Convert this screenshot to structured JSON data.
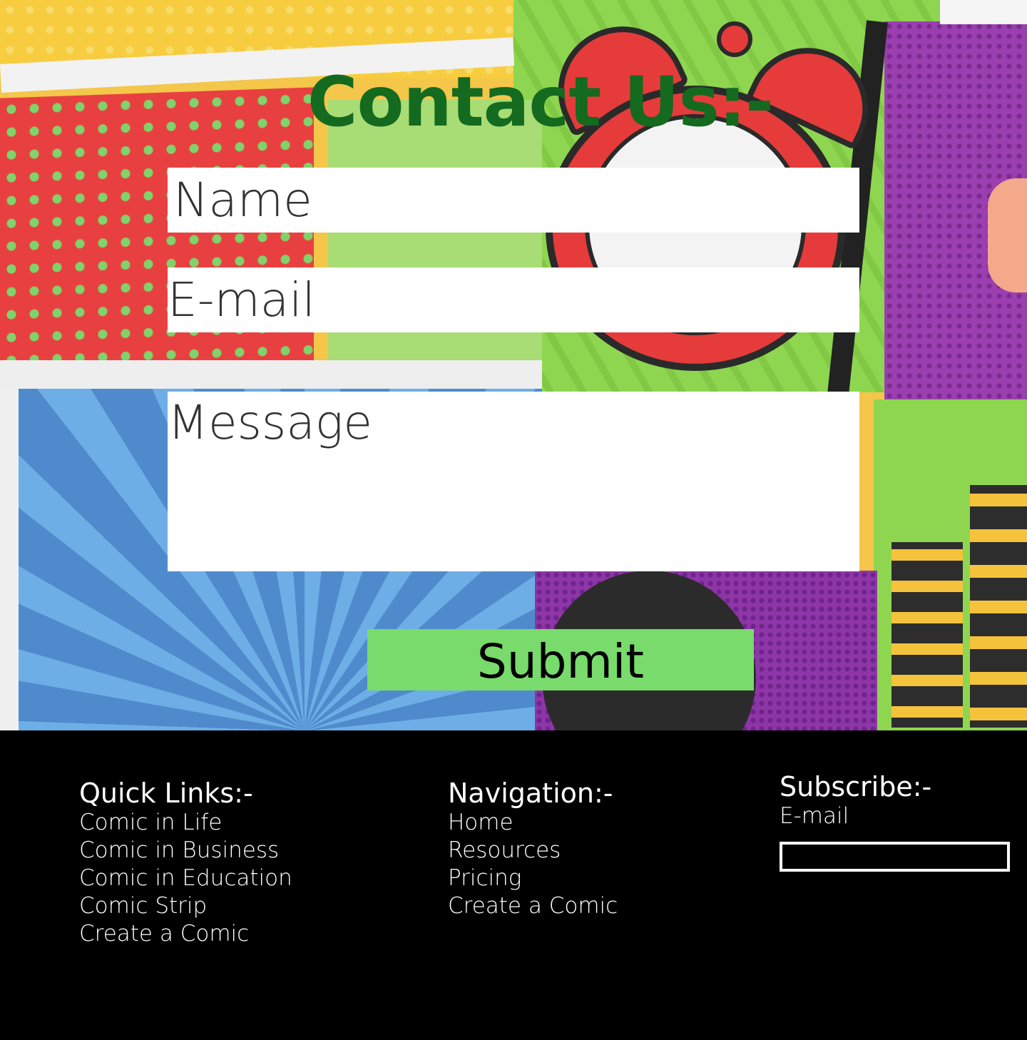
{
  "contact": {
    "title": "Contact Us:-",
    "title_color": "#146a1e",
    "name_placeholder": "Name",
    "email_placeholder": "E-mail",
    "message_placeholder": "Message",
    "submit_label": "Submit",
    "submit_color": "#79db6c"
  },
  "footer": {
    "quick_links": {
      "heading": "Quick Links:-",
      "items": [
        "Comic in Life",
        "Comic in Business",
        "Comic in Education",
        "Comic Strip",
        "Create a Comic"
      ]
    },
    "navigation": {
      "heading": "Navigation:-",
      "items": [
        "Home",
        "Resources",
        "Pricing",
        "Create a Comic"
      ]
    },
    "subscribe": {
      "heading": "Subscribe:-",
      "email_label": "E-mail",
      "email_value": ""
    }
  }
}
